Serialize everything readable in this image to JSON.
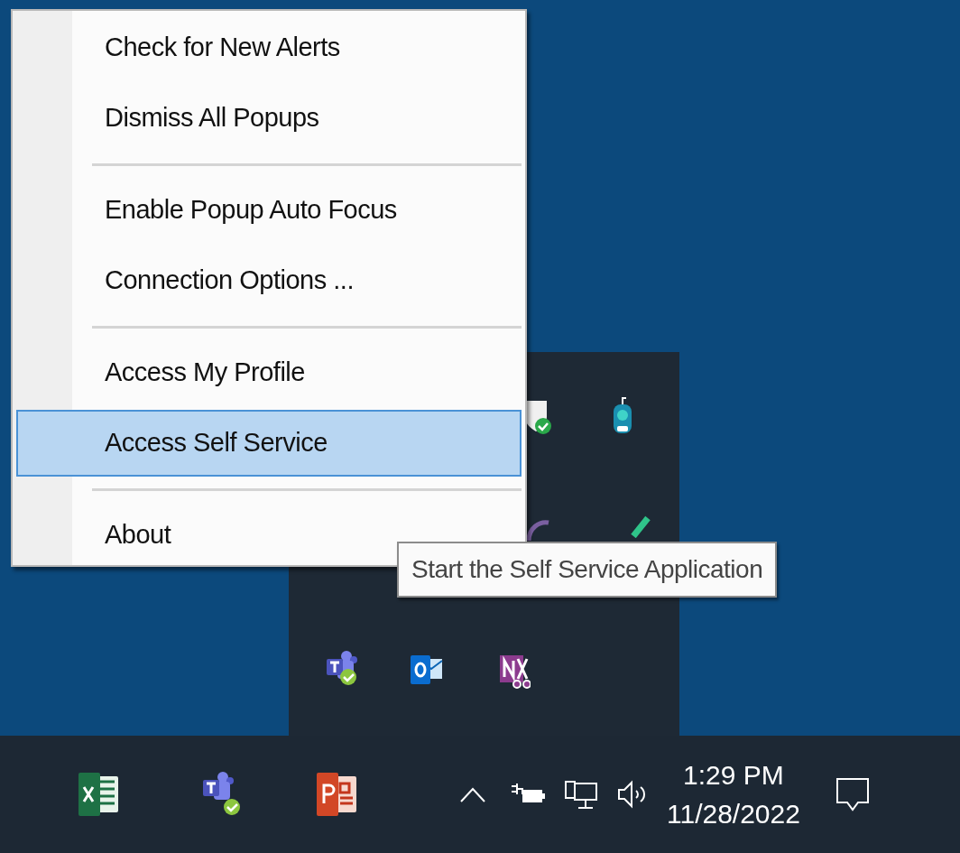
{
  "context_menu": {
    "items": [
      {
        "kind": "item",
        "label": "Check for New Alerts",
        "selected": false
      },
      {
        "kind": "item",
        "label": "Dismiss All Popups",
        "selected": false
      },
      {
        "kind": "separator"
      },
      {
        "kind": "item",
        "label": "Enable Popup Auto Focus",
        "selected": false
      },
      {
        "kind": "item",
        "label": "Connection Options ...",
        "selected": false
      },
      {
        "kind": "separator"
      },
      {
        "kind": "item",
        "label": "Access My Profile",
        "selected": false
      },
      {
        "kind": "item",
        "label": "Access Self Service",
        "selected": true
      },
      {
        "kind": "separator"
      },
      {
        "kind": "item",
        "label": "About",
        "selected": false
      }
    ]
  },
  "tooltip": {
    "text": "Start the Self Service Application"
  },
  "taskbar": {
    "clock": {
      "time": "1:29 PM",
      "date": "11/28/2022"
    }
  }
}
